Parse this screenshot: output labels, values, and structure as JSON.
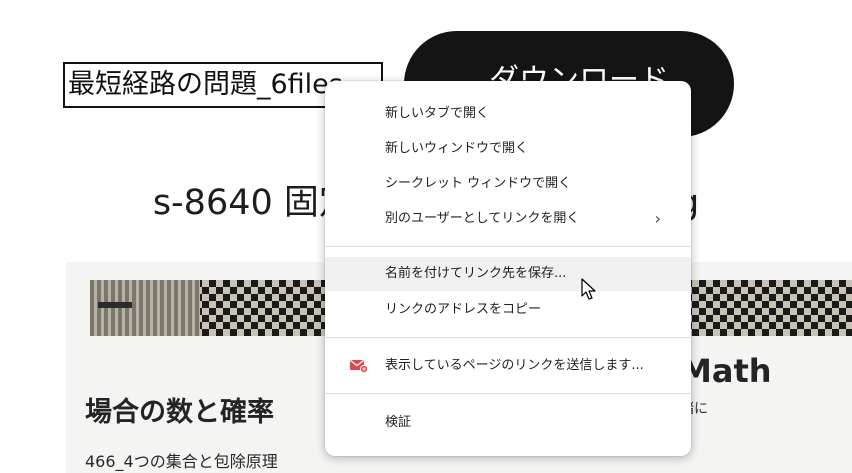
{
  "header": {
    "folder_title": "最短経路の問題_6files",
    "download_label": "ダウンロード"
  },
  "file": {
    "name": "s-8640 固定した道を通る確率.jpg"
  },
  "preview": {
    "heading": "場合の数と確率",
    "subheading": "466_4つの集合と包除原理",
    "math_label": "Math",
    "math_sub": "緒に"
  },
  "context_menu": {
    "items": [
      {
        "label": "新しいタブで開く"
      },
      {
        "label": "新しいウィンドウで開く"
      },
      {
        "label": "シークレット ウィンドウで開く"
      },
      {
        "label": "別のユーザーとしてリンクを開く",
        "submenu_arrow": "›"
      },
      {
        "label": "名前を付けてリンク先を保存..."
      },
      {
        "label": "リンクのアドレスをコピー"
      },
      {
        "label": "表示しているページのリンクを送信します...",
        "icon": "mail-icon"
      },
      {
        "label": "検証"
      }
    ],
    "hovered_item": "名前を付けてリンク先を保存..."
  },
  "colors": {
    "download_bg": "#141414",
    "mail_icon": "#e0474c",
    "divider": "#d3e3ec",
    "hover_bg": "#f0f0f0"
  }
}
